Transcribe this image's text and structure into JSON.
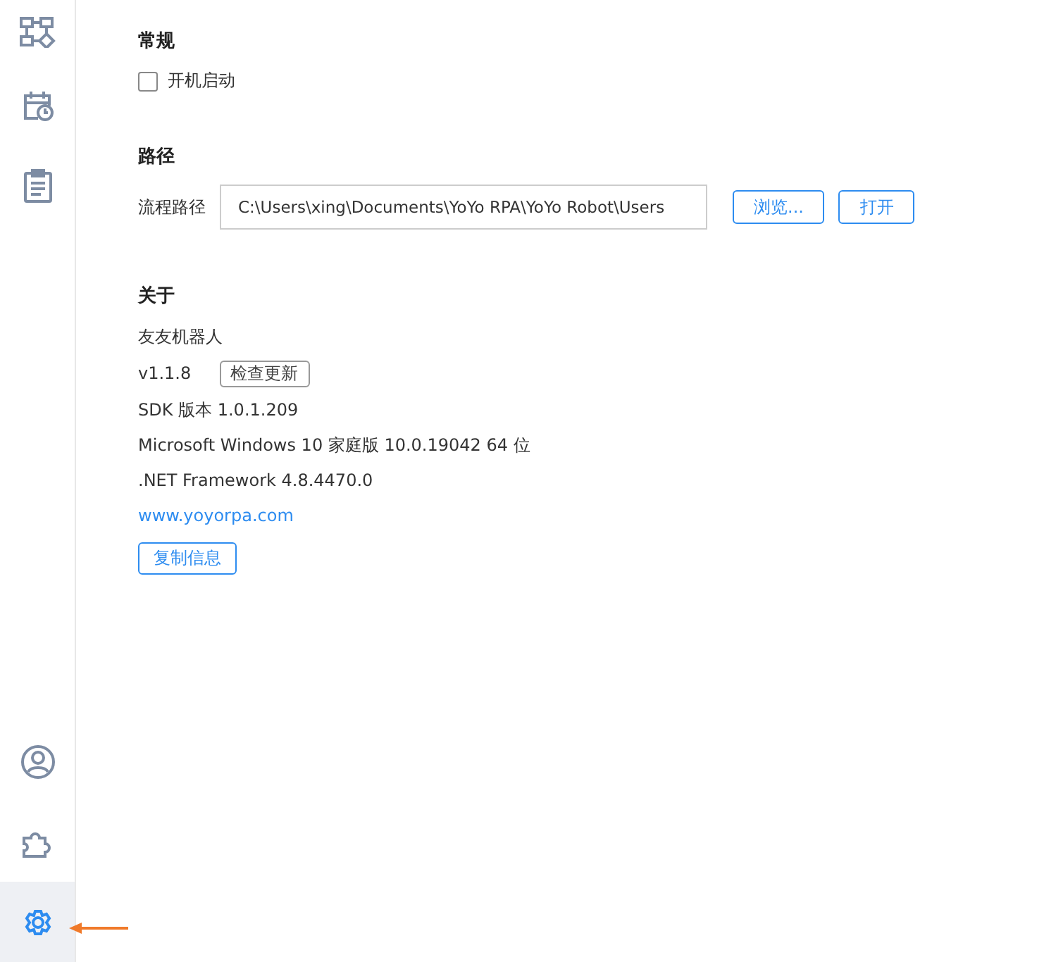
{
  "sidebar": {
    "top_items": [
      {
        "selected": false
      },
      {
        "selected": false
      },
      {
        "selected": false
      }
    ],
    "bottom_items": [
      {
        "selected": false
      },
      {
        "selected": false
      },
      {
        "selected": true
      }
    ]
  },
  "general": {
    "title": "常规",
    "autostart": {
      "label": "开机启动",
      "checked": false
    }
  },
  "path": {
    "title": "路径",
    "label": "流程路径",
    "value": "C:\\Users\\xing\\Documents\\YoYo RPA\\YoYo Robot\\Users",
    "buttons": [
      "浏览...",
      "打开"
    ]
  },
  "about": {
    "title": "关于",
    "app_name": "友友机器人",
    "version": "v1.1.8",
    "update_button": "检查更新",
    "sdk": "SDK 版本 1.0.1.209",
    "os": "Microsoft Windows 10 家庭版 10.0.19042 64 位",
    "framework": ".NET Framework 4.8.4470.0",
    "link": "www.yoyorpa.com",
    "copy_button": "复制信息"
  }
}
